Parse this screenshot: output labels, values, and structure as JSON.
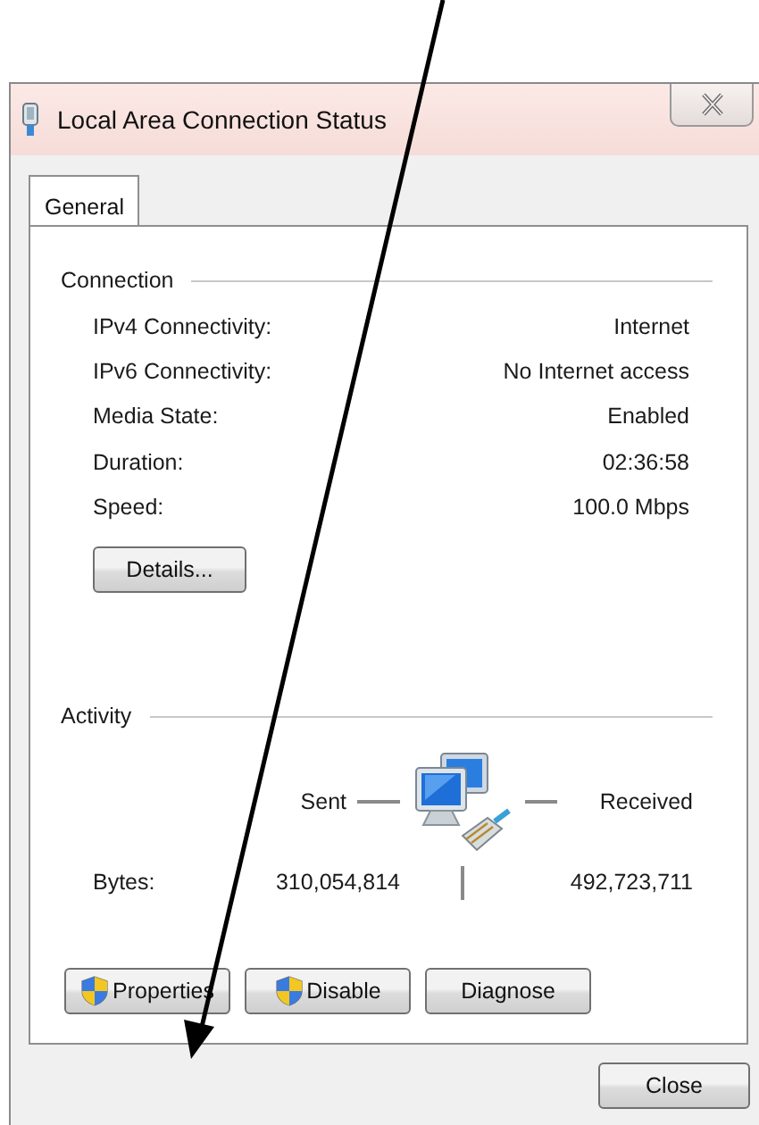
{
  "window": {
    "title": "Local Area Connection Status"
  },
  "tabs": [
    {
      "label": "General",
      "selected": true
    }
  ],
  "connection": {
    "heading": "Connection",
    "rows": [
      {
        "label": "IPv4 Connectivity:",
        "value": "Internet"
      },
      {
        "label": "IPv6 Connectivity:",
        "value": "No Internet access"
      },
      {
        "label": "Media State:",
        "value": "Enabled"
      },
      {
        "label": "Duration:",
        "value": "02:36:58"
      },
      {
        "label": "Speed:",
        "value": "100.0 Mbps"
      }
    ],
    "details_button": "Details..."
  },
  "activity": {
    "heading": "Activity",
    "sent_label": "Sent",
    "received_label": "Received",
    "bytes_label": "Bytes:",
    "bytes_sent": "310,054,814",
    "bytes_received": "492,723,711"
  },
  "buttons": [
    {
      "label": "Properties",
      "kind": "shield"
    },
    {
      "label": "Disable",
      "kind": "shield"
    },
    {
      "label": "Diagnose",
      "kind": "plain"
    }
  ],
  "close_button": "Close"
}
